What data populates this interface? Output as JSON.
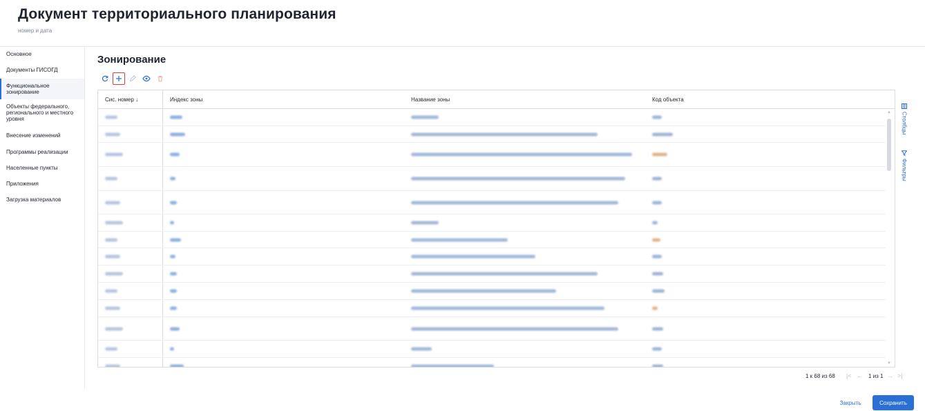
{
  "header": {
    "title": "Документ территориального планирования",
    "subtitle": "номер и дата"
  },
  "sidebar": {
    "items": [
      {
        "label": "Основное"
      },
      {
        "label": "Документы ГИСОГД"
      },
      {
        "label": "Функциональное зонирование",
        "active": true
      },
      {
        "label": "Объекты федерального, регионального и местного уровня"
      },
      {
        "label": "Внесение изменений"
      },
      {
        "label": "Программы реализации"
      },
      {
        "label": "Населенные пункты"
      },
      {
        "label": "Приложения"
      },
      {
        "label": "Загрузка материалов"
      }
    ]
  },
  "main": {
    "section_title": "Зонирование",
    "toolbar": {
      "icons": [
        "refresh-icon",
        "plus-icon",
        "pencil-icon",
        "eye-icon",
        "trash-icon"
      ]
    },
    "table": {
      "columns": [
        "Сис. номер ↓",
        "Индекс зоны",
        "Название зоны",
        "Код объекта"
      ],
      "row_count_visible": 15,
      "rows_note_blurred": true
    },
    "rail": {
      "columns_label": "Столбцы",
      "filters_label": "Фильтры"
    },
    "pagination": {
      "range": "1 к 68 из 68",
      "page": "1 из 1"
    }
  },
  "footer": {
    "close_label": "Закрыть",
    "save_label": "Сохранить"
  },
  "colors": {
    "accent": "#2a6fd6",
    "danger": "#e53935",
    "border": "#d8dce3"
  }
}
